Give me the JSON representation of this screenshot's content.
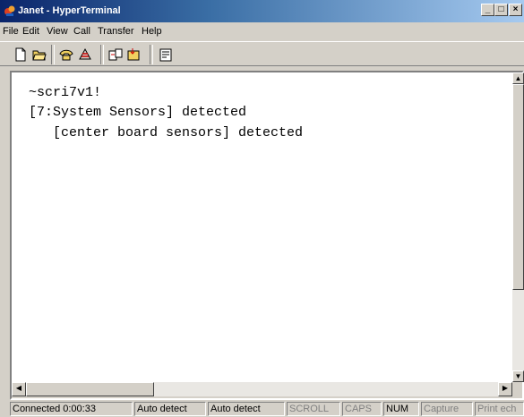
{
  "window": {
    "title": "Janet - HyperTerminal",
    "buttons": {
      "minimize": "_",
      "maximize": "□",
      "close": "×"
    }
  },
  "menu": [
    "File",
    "Edit",
    "View",
    "Call",
    "Transfer",
    "Help"
  ],
  "toolbar": [
    "new-document-icon",
    "open-folder-icon",
    "dial-phone-icon",
    "disconnect-phone-icon",
    "send-file-icon",
    "receive-file-icon",
    "properties-icon"
  ],
  "terminal": {
    "lines": [
      "~scri7v1!",
      "[7:System Sensors] detected",
      "   [center board sensors] detected"
    ]
  },
  "status": {
    "connected": "Connected 0:00:33",
    "detect1": "Auto detect",
    "detect2": "Auto detect",
    "scroll": "SCROLL",
    "caps": "CAPS",
    "num": "NUM",
    "capture": "Capture",
    "print": "Print ech"
  }
}
